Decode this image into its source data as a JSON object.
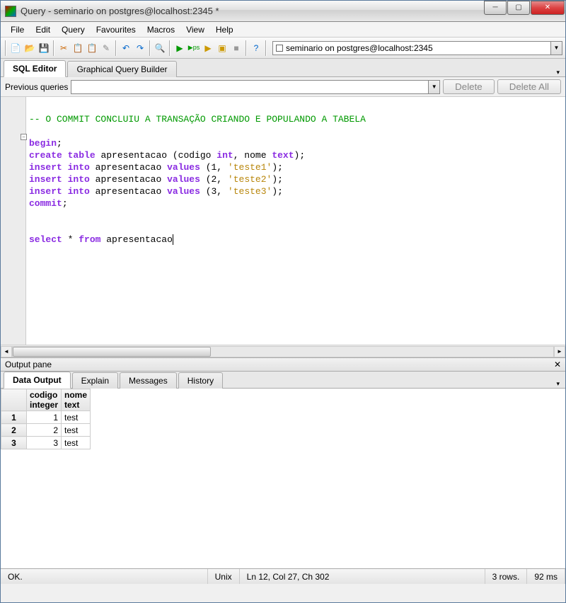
{
  "window": {
    "title": "Query - seminario on postgres@localhost:2345 *"
  },
  "menu": {
    "file": "File",
    "edit": "Edit",
    "query": "Query",
    "favourites": "Favourites",
    "macros": "Macros",
    "view": "View",
    "help": "Help"
  },
  "connection": {
    "current": "seminario on postgres@localhost:2345"
  },
  "tabs": {
    "sql_editor": "SQL Editor",
    "gqb": "Graphical Query Builder"
  },
  "prev_queries": {
    "label": "Previous queries",
    "delete": "Delete",
    "delete_all": "Delete All"
  },
  "sql": {
    "comment": "-- O COMMIT CONCLUIU A TRANSAÇÃO CRIANDO E POPULANDO A TABELA",
    "begin": "begin",
    "create": "create",
    "table": "table",
    "tbname": "apresentacao",
    "coldef": " (codigo ",
    "int": "int",
    "comma_nome": ", nome ",
    "text": "text",
    "close_paren": ");",
    "insert": "insert",
    "into": "into",
    "values": "values",
    "v1a": " (1, ",
    "v1b": "'teste1'",
    "v2a": " (2, ",
    "v2b": "'teste2'",
    "v3a": " (3, ",
    "v3b": "'teste3'",
    "close_stmt": ");",
    "commit": "commit",
    "select": "select",
    "star": " * ",
    "from": "from",
    "semicolon": ";"
  },
  "output": {
    "pane_title": "Output pane",
    "tabs": {
      "data": "Data Output",
      "explain": "Explain",
      "messages": "Messages",
      "history": "History"
    },
    "columns": [
      {
        "name": "codigo",
        "type": "integer"
      },
      {
        "name": "nome",
        "type": "text"
      }
    ],
    "rows": [
      {
        "n": "1",
        "codigo": "1",
        "nome": "test"
      },
      {
        "n": "2",
        "codigo": "2",
        "nome": "test"
      },
      {
        "n": "3",
        "codigo": "3",
        "nome": "test"
      }
    ]
  },
  "status": {
    "msg": "OK.",
    "enc": "Unix",
    "pos": "Ln 12, Col 27, Ch 302",
    "rows": "3 rows.",
    "time": "92 ms"
  }
}
